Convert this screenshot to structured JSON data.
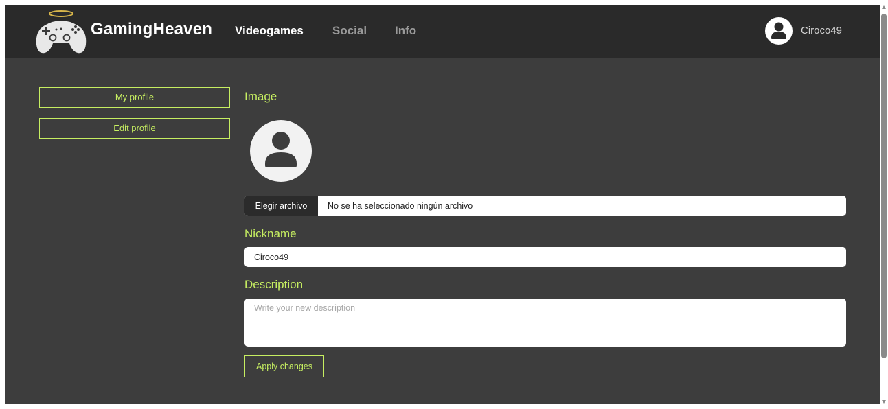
{
  "navbar": {
    "brand": "GamingHeaven",
    "links": [
      {
        "label": "Videogames",
        "active": true
      },
      {
        "label": "Social",
        "active": false
      },
      {
        "label": "Info",
        "active": false
      }
    ],
    "user": {
      "name": "Ciroco49",
      "icon": "user-circle-icon"
    }
  },
  "sidebar": {
    "items": [
      {
        "label": "My profile"
      },
      {
        "label": "Edit profile"
      }
    ]
  },
  "form": {
    "image_label": "Image",
    "file_button_label": "Elegir archivo",
    "file_status": "No se ha seleccionado ningún archivo",
    "nickname_label": "Nickname",
    "nickname_value": "Ciroco49",
    "description_label": "Description",
    "description_placeholder": "Write your new description",
    "apply_label": "Apply changes"
  },
  "colors": {
    "accent": "#c6ee61",
    "navbar_bg": "#2a2a2a",
    "page_bg": "#3d3d3d"
  }
}
